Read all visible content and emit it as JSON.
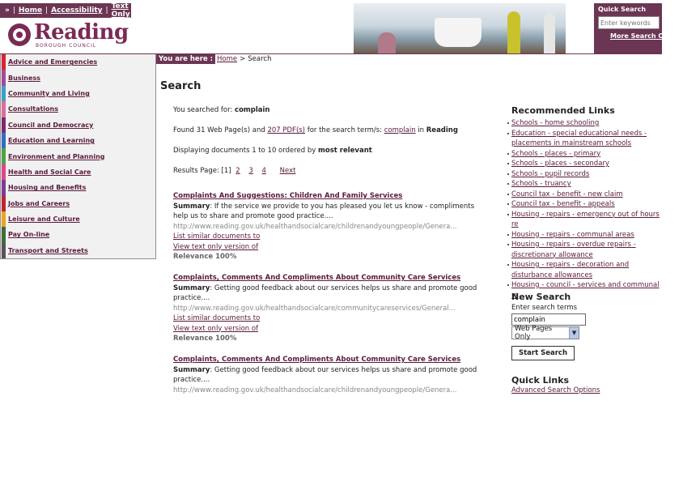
{
  "topbar": {
    "arrow": "»",
    "home": "Home",
    "accessibility": "Accessibility",
    "text_only": "Text Only",
    "sep": "|"
  },
  "logo": {
    "name": "Reading",
    "sub": "BOROUGH COUNCIL"
  },
  "quick_search": {
    "title": "Quick Search",
    "placeholder": "Enter keywords",
    "more": "More Search Opti"
  },
  "sidebar": {
    "items": [
      {
        "label": "Advice and Emergencies",
        "color": "#d6262f"
      },
      {
        "label": "Business",
        "color": "#a04c9c"
      },
      {
        "label": "Community and Living",
        "color": "#3aa0c8"
      },
      {
        "label": "Consultations",
        "color": "#e06a9a"
      },
      {
        "label": "Council and Democracy",
        "color": "#7a2a6e"
      },
      {
        "label": "Education and Learning",
        "color": "#2e6fc2"
      },
      {
        "label": "Environment and Planning",
        "color": "#4ea341"
      },
      {
        "label": "Health and Social Care",
        "color": "#e0458a"
      },
      {
        "label": "Housing and Benefits",
        "color": "#7c3c93"
      },
      {
        "label": "Jobs and Careers",
        "color": "#c0252d"
      },
      {
        "label": "Leisure and Culture",
        "color": "#e8a51f"
      },
      {
        "label": "Pay On-line",
        "color": "#3c6e3a"
      },
      {
        "label": "Transport and Streets",
        "color": "#555555"
      }
    ]
  },
  "breadcrumb": {
    "you_are_here": "You are here :",
    "home": "Home",
    "sep": ">",
    "current": "Search"
  },
  "page_title": "Search",
  "results_info": {
    "searched_for_label": "You searched for:",
    "searched_for_term": "complain",
    "found_prefix": "Found 31 Web Page(s) and",
    "found_pdfs": "207 PDF(s)",
    "found_mid": "for the search term/s:",
    "found_term": "complain",
    "found_in": "in",
    "found_site": "Reading",
    "displaying_prefix": "Displaying documents 1 to 10 ordered by",
    "displaying_order": "most relevant",
    "pages_label": "Results Page: [1]",
    "page_2": "2",
    "page_3": "3",
    "page_4": "4",
    "next": "Next"
  },
  "results": [
    {
      "title": "Complaints And Suggestions: Children And Family Services",
      "summary_label": "Summary",
      "summary": ": If the service we provide to you has pleased you let us know - compliments help us to share and promote good practice....",
      "url": "http://www.reading.gov.uk/healthandsocialcare/childrenandyoungpeople/Genera...",
      "similar": "List similar documents to",
      "text_only": "View text only version of",
      "relevance": "Relevance 100%"
    },
    {
      "title": "Complaints, Comments And Compliments About Community Care Services",
      "summary_label": "Summary",
      "summary": ": Getting good feedback about our services helps us share and promote good practice....",
      "url": "http://www.reading.gov.uk/healthandsocialcare/communitycareservices/General...",
      "similar": "List similar documents to",
      "text_only": "View text only version of",
      "relevance": "Relevance 100%"
    },
    {
      "title": "Complaints, Comments And Compliments About Community Care Services",
      "summary_label": "Summary",
      "summary": ": Getting good feedback about our services helps us share and promote good practice....",
      "url": "http://www.reading.gov.uk/healthandsocialcare/childrenandyoungpeople/Genera..."
    }
  ],
  "recommended": {
    "title": "Recommended Links",
    "links": [
      "Schools - home schooling",
      "Education - special educational needs - placements in mainstream schools",
      "Schools - places - primary",
      "Schools - places - secondary",
      "Schools - pupil records",
      "Schools - truancy",
      "Council tax - benefit - new claim",
      "Council tax - benefit - appeals",
      "Housing - repairs - emergency out of hours re",
      "Housing - repairs - communal areas",
      "Housing - repairs - overdue repairs - discretionary allowance",
      "Housing - repairs - decoration and disturbance allowances",
      "Housing - council - services and communal re"
    ]
  },
  "new_search": {
    "title": "New Search",
    "label": "Enter search terms",
    "value": "complain",
    "select": "Web Pages Only",
    "button": "Start Search"
  },
  "quick_links": {
    "title": "Quick Links",
    "first": "Advanced Search Options"
  }
}
